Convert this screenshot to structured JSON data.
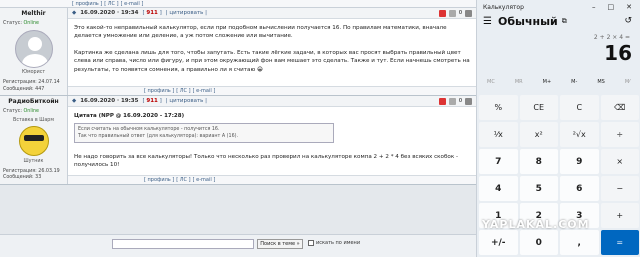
{
  "forum": {
    "top_links": [
      "[ профиль ]",
      "[ ЛС ]",
      "[ e-mail ]"
    ],
    "posts": [
      {
        "user": "Melthir",
        "status_label": "Статус:",
        "status": "Online",
        "rank": "Юморист",
        "reg": "Регистрация: 24.07.14",
        "msgs": "Сообщений: 447",
        "date": "16.09.2020 · 19:34",
        "num": "911",
        "quote_btn": "цитировать",
        "text": "Это какой-то неправильный калькулятор, если при подобном вычислении получается 16. По правилам математики, вначале делается умножение или деление, а уж потом сложение или вычитание.",
        "text2": "Картинка же сделана лишь для того, чтобы запутать. Есть такие лёгкие задачи, в которых вас просят выбрать правильный цвет слева или справа, число или фигуру, и при этом окружающий фон вам мешает это сделать. Также и тут. Если начнешь смотреть на результаты, то появятся сомнения, а правильно ли я считаю 😁",
        "links": [
          "[ профиль ]",
          "[ ЛС ]",
          "[ e-mail ]"
        ]
      },
      {
        "user": "РадиоБиткойн",
        "status_label": "Статус:",
        "status": "Online",
        "pre": "Вставка в Шарм",
        "rank": "Шутник",
        "reg": "Регистрация: 26.03.19",
        "msgs": "Сообщений: 33",
        "date": "16.09.2020 · 19:35",
        "num": "911",
        "quote_btn": "цитировать",
        "qhead": "Цитата (NPP @ 16.09.2020 - 17:28)",
        "q1": "Если считать на обычном калькуляторе - получится 16.",
        "q2": "Так что правильный ответ (для калькулятора): вариант А (16).",
        "text": "Не надо говорить за все калькуляторы! Только что несколько раз проверил на калькуляторе компа 2 + 2 * 4 без всяких скобок - получилось 10!",
        "links": [
          "[ профиль ]",
          "[ ЛС ]",
          "[ e-mail ]"
        ]
      }
    ],
    "search_btn": "Поиск в теме »",
    "checkbox": "искать по имени"
  },
  "calc": {
    "title": "Калькулятор",
    "mode": "Обычный",
    "expr": "2 + 2 × 4 =",
    "display": "16",
    "mem": [
      "MC",
      "MR",
      "M+",
      "M-",
      "MS",
      "M⁄"
    ],
    "keys": [
      "%",
      "CE",
      "C",
      "⌫",
      "⅟x",
      "x²",
      "²√x",
      "÷",
      "7",
      "8",
      "9",
      "×",
      "4",
      "5",
      "6",
      "−",
      "1",
      "2",
      "3",
      "+",
      "+/-",
      "0",
      ",",
      "="
    ]
  },
  "watermark": "YAPLAKAL.COM"
}
